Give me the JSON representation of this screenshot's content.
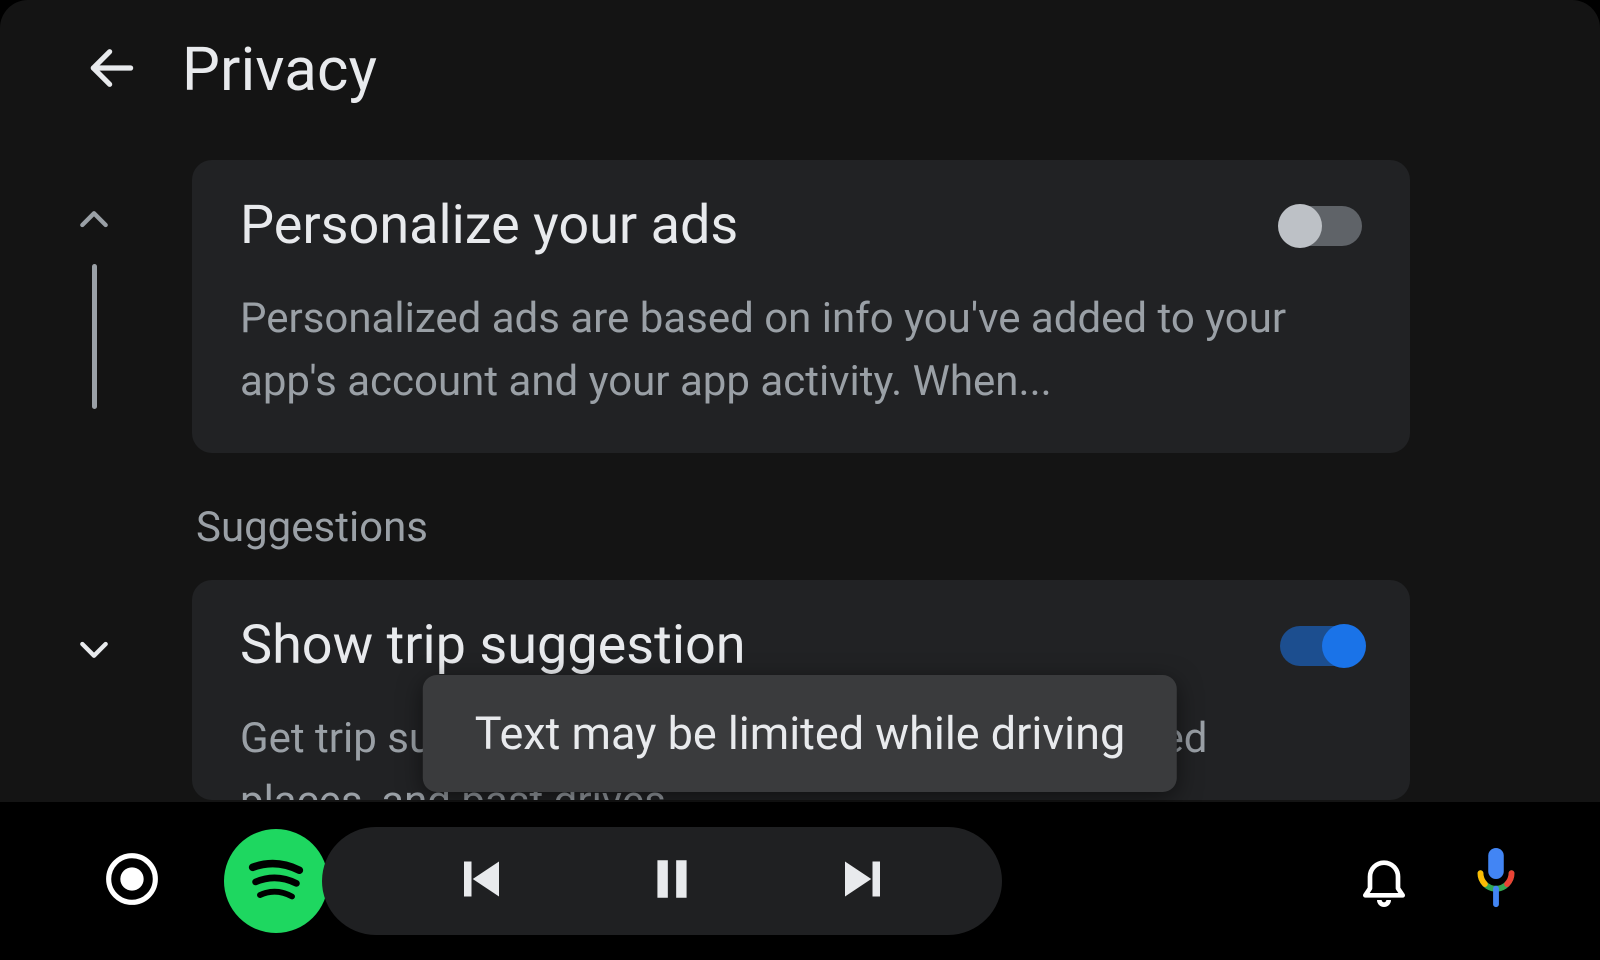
{
  "header": {
    "title": "Privacy"
  },
  "settings": {
    "personalize_ads": {
      "label": "Personalize your ads",
      "description": "Personalized ads are based on info you've added to your app's account and your app activity. When...",
      "enabled": false
    },
    "suggestions_heading": "Suggestions",
    "trip_suggestion": {
      "label": "Show trip suggestion",
      "description": "Get trip suggestions based on your commute, saved places, and past drives",
      "enabled": true
    }
  },
  "toast": {
    "message": "Text may be limited while driving"
  },
  "bottombar": {
    "media_app": "spotify"
  },
  "colors": {
    "accent": "#1a73e8",
    "spotify": "#1ed760"
  }
}
